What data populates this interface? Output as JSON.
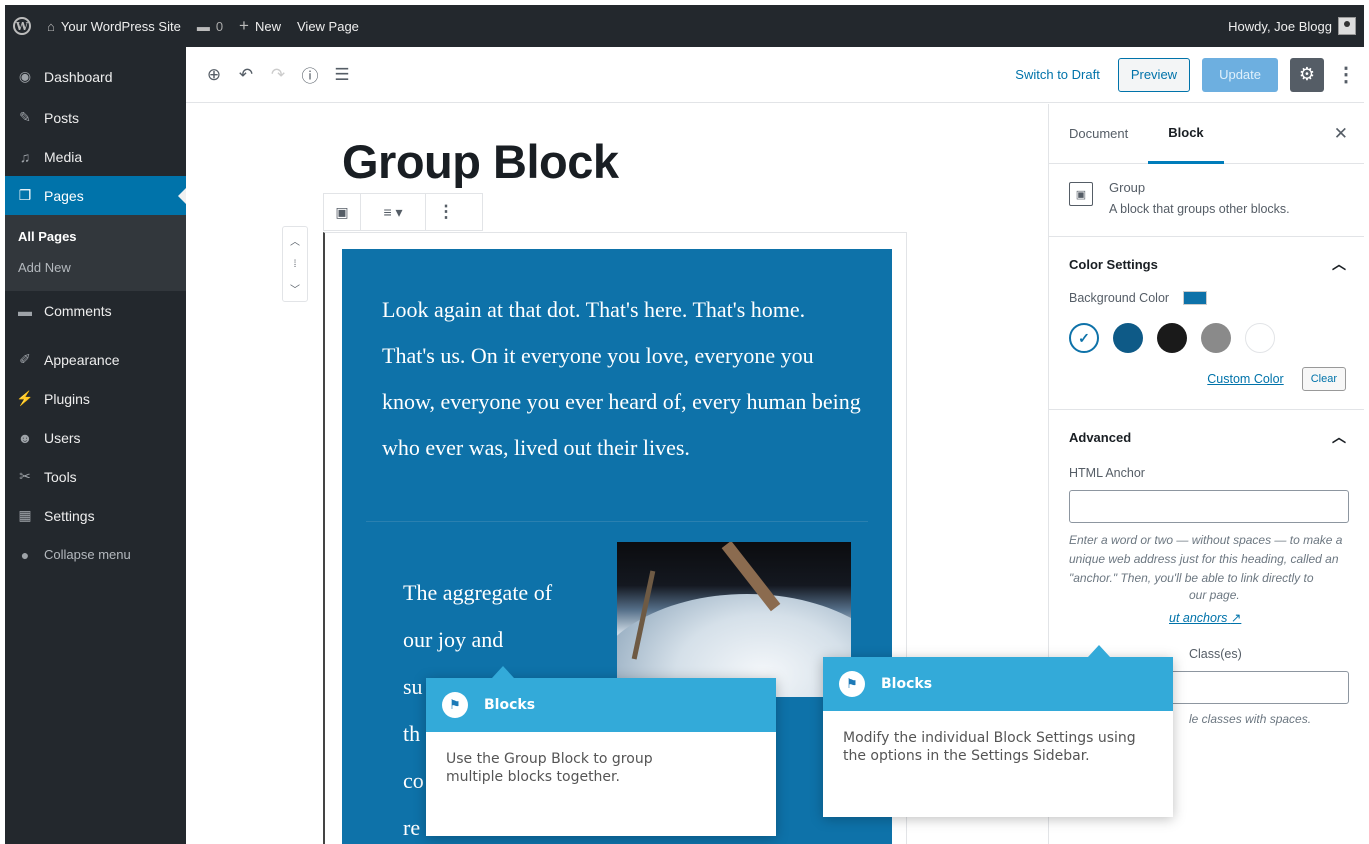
{
  "adminbar": {
    "site_name": "Your WordPress Site",
    "comments_count": "0",
    "new_label": "New",
    "view_page_label": "View Page",
    "howdy": "Howdy, Joe Blogg"
  },
  "sidebar": {
    "items": [
      {
        "label": "Dashboard",
        "icon": "dashboard-icon"
      },
      {
        "label": "Posts",
        "icon": "pin-icon"
      },
      {
        "label": "Media",
        "icon": "media-icon"
      },
      {
        "label": "Pages",
        "icon": "pages-icon"
      },
      {
        "label": "Comments",
        "icon": "comment-icon"
      },
      {
        "label": "Appearance",
        "icon": "brush-icon"
      },
      {
        "label": "Plugins",
        "icon": "plug-icon"
      },
      {
        "label": "Users",
        "icon": "user-icon"
      },
      {
        "label": "Tools",
        "icon": "wrench-icon"
      },
      {
        "label": "Settings",
        "icon": "settings-icon"
      },
      {
        "label": "Collapse menu",
        "icon": "collapse-icon"
      }
    ],
    "submenu": [
      "All Pages",
      "Add New"
    ]
  },
  "toolbar": {
    "switch_draft": "Switch to Draft",
    "preview": "Preview",
    "update": "Update"
  },
  "editor": {
    "title": "Group Block",
    "group_paragraph": "Look again at that dot. That's here. That's home. That's us. On it everyone you love, everyone you know, everyone you ever heard of, every human being who ever was, lived out their lives.",
    "inner_lines": [
      "The aggregate of",
      "our joy and",
      "su",
      "th",
      "co",
      "re"
    ]
  },
  "settings_panel": {
    "tab_document": "Document",
    "tab_block": "Block",
    "block_name": "Group",
    "block_description": "A block that groups other blocks.",
    "color_settings_title": "Color Settings",
    "background_color_label": "Background Color",
    "background_color": "#0e72a9",
    "palette": [
      "#ffffff",
      "#0e5a87",
      "#1a1a1a",
      "#8a8a8a",
      "#ffffff"
    ],
    "custom_color": "Custom Color",
    "clear": "Clear",
    "advanced_title": "Advanced",
    "html_anchor_label": "HTML Anchor",
    "html_anchor_help": "Enter a word or two — without spaces — to make a unique web address just for this heading, called an \"anchor.\" Then, you'll be able to link directly to",
    "html_anchor_help_tail": "our page.",
    "anchor_link": "ut anchors",
    "css_label_tail": "Class(es)",
    "css_help_tail": "le classes with spaces."
  },
  "tooltips": [
    {
      "title": "Blocks",
      "body": "Use the Group Block to group multiple blocks together."
    },
    {
      "title": "Blocks",
      "body": "Modify the individual Block Settings using the options in the Settings Sidebar."
    }
  ]
}
